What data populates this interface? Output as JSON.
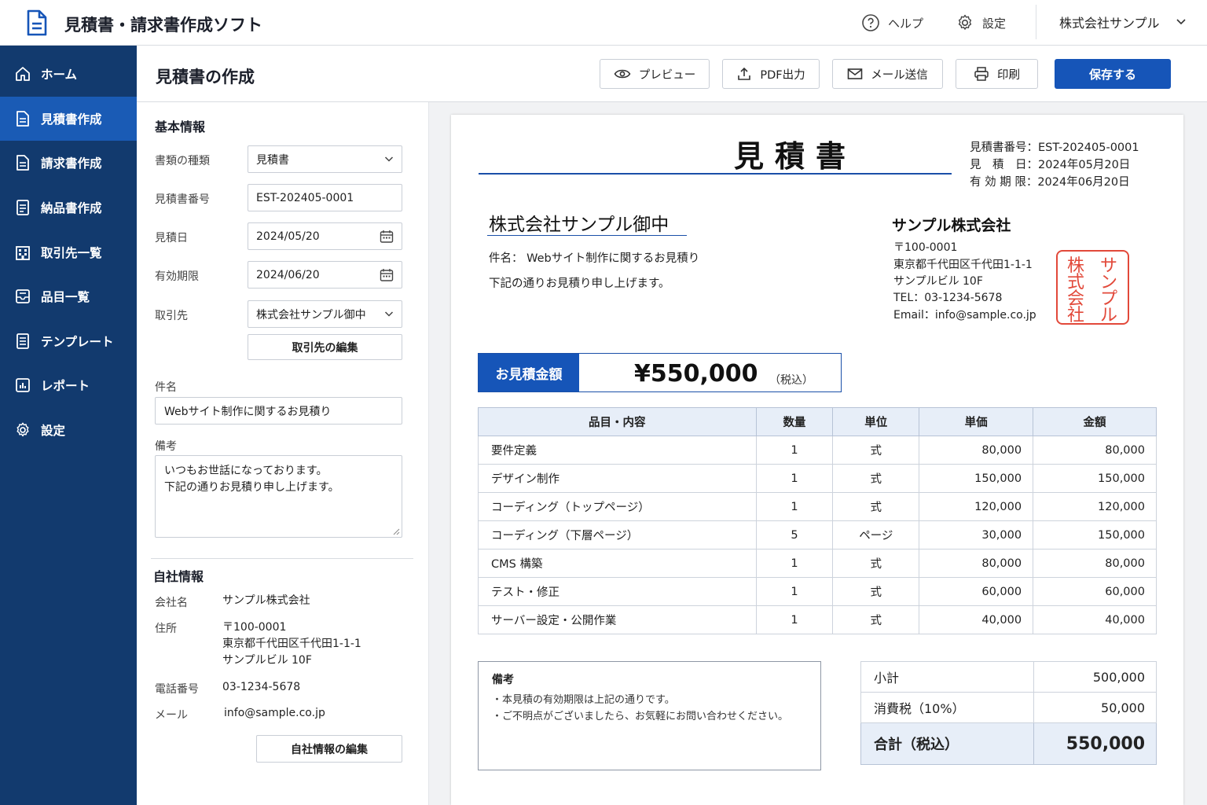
{
  "app": {
    "title": "見積書・請求書作成ソフト",
    "help_label": "ヘルプ",
    "settings_label": "設定",
    "company_selector": "株式会社サンプル"
  },
  "sidebar": {
    "items": [
      {
        "label": "ホーム",
        "icon": "home-icon"
      },
      {
        "label": "見積書作成",
        "icon": "document-icon",
        "active": true
      },
      {
        "label": "請求書作成",
        "icon": "document-icon"
      },
      {
        "label": "納品書作成",
        "icon": "list-document-icon"
      },
      {
        "label": "取引先一覧",
        "icon": "building-icon"
      },
      {
        "label": "品目一覧",
        "icon": "inbox-icon"
      },
      {
        "label": "テンプレート",
        "icon": "template-icon"
      },
      {
        "label": "レポート",
        "icon": "chart-icon"
      },
      {
        "label": "設定",
        "icon": "gear-icon"
      }
    ]
  },
  "toolbar": {
    "page_title": "見積書の作成",
    "preview_label": "プレビュー",
    "pdf_label": "PDF出力",
    "mail_label": "メール送信",
    "print_label": "印刷",
    "save_label": "保存する"
  },
  "form": {
    "basic_title": "基本情報",
    "doc_type_label": "書類の種類",
    "doc_type_value": "見積書",
    "number_label": "見積書番号",
    "number_value": "EST-202405-0001",
    "date_label": "見積日",
    "date_value": "2024/05/20",
    "expiry_label": "有効期限",
    "expiry_value": "2024/06/20",
    "client_label": "取引先",
    "client_value": "株式会社サンプル御中",
    "edit_client_label": "取引先の編集",
    "subject_label": "件名",
    "subject_value": "Webサイト制作に関するお見積り",
    "remarks_label": "備考",
    "remarks_line1": "いつもお世話になっております。",
    "remarks_line2": "下記の通りお見積り申し上げます。",
    "company_title": "自社情報",
    "company_name_label": "会社名",
    "company_name_value": "サンプル株式会社",
    "address_label": "住所",
    "address_line1": "〒100-0001",
    "address_line2": "東京都千代田区千代田1-1-1",
    "address_line3": "サンプルビル 10F",
    "phone_label": "電話番号",
    "phone_value": "03-1234-5678",
    "email_label": "メール",
    "email_value": "info@sample.co.jp",
    "edit_company_label": "自社情報の編集"
  },
  "doc": {
    "title": "見積書",
    "meta": [
      "見積書番号：EST-202405-0001",
      "見　積　日：2024年05月20日",
      "有 効 期 限：2024年06月20日"
    ],
    "recipient": "株式会社サンプル御中",
    "subject": "件名： Webサイト制作に関するお見積り",
    "greeting": "下記の通りお見積り申し上げます。",
    "issuer": {
      "name": "サンプル株式会社",
      "postal": "〒100-0001",
      "address": "東京都千代田区千代田1-1-1",
      "building": "サンプルビル 10F",
      "tel": "TEL：03-1234-5678",
      "email": "Email：info@sample.co.jp"
    },
    "seal": [
      "サ",
      "株",
      "ン",
      "式",
      "プ",
      "会",
      "ル",
      "社"
    ],
    "total_label": "お見積金額",
    "total_amount": "¥550,000",
    "total_tax_note": "（税込）",
    "table_headers": [
      "品目・内容",
      "数量",
      "単位",
      "単価",
      "金額"
    ],
    "items": [
      {
        "name": "要件定義",
        "qty": "1",
        "unit": "式",
        "price": "80,000",
        "amount": "80,000"
      },
      {
        "name": "デザイン制作",
        "qty": "1",
        "unit": "式",
        "price": "150,000",
        "amount": "150,000"
      },
      {
        "name": "コーディング（トップページ）",
        "qty": "1",
        "unit": "式",
        "price": "120,000",
        "amount": "120,000"
      },
      {
        "name": "コーディング（下層ページ）",
        "qty": "5",
        "unit": "ページ",
        "price": "30,000",
        "amount": "150,000"
      },
      {
        "name": "CMS 構築",
        "qty": "1",
        "unit": "式",
        "price": "80,000",
        "amount": "80,000"
      },
      {
        "name": "テスト・修正",
        "qty": "1",
        "unit": "式",
        "price": "60,000",
        "amount": "60,000"
      },
      {
        "name": "サーバー設定・公開作業",
        "qty": "1",
        "unit": "式",
        "price": "40,000",
        "amount": "40,000"
      }
    ],
    "notes_title": "備考",
    "notes": [
      "・本見積の有効期限は上記の通りです。",
      "・ご不明点がございましたら、お気軽にお問い合わせください。"
    ],
    "subtotal_label": "小計",
    "subtotal_value": "500,000",
    "tax_label": "消費税（10%）",
    "tax_value": "50,000",
    "grand_label": "合計（税込）",
    "grand_value": "550,000"
  },
  "colors": {
    "sidebar": "#123a6e",
    "sidebar_active": "#1a5bb5",
    "primary": "#1655b8",
    "seal": "#e2493a"
  }
}
